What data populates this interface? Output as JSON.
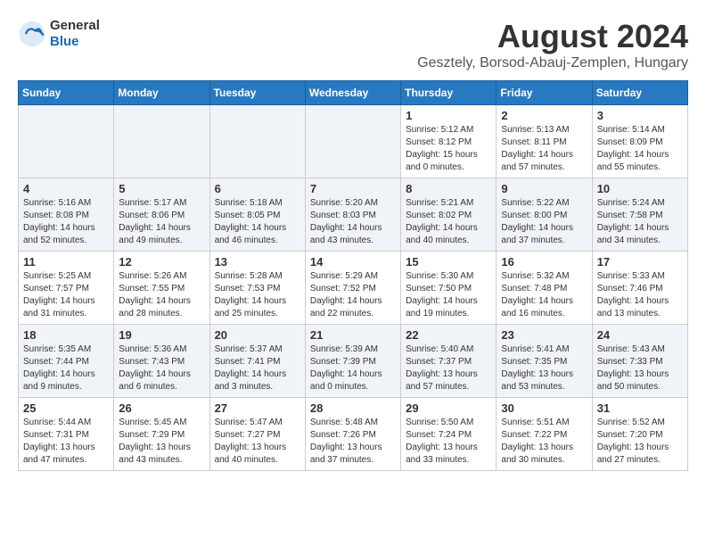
{
  "header": {
    "logo_general": "General",
    "logo_blue": "Blue",
    "month_year": "August 2024",
    "location": "Gesztely, Borsod-Abauj-Zemplen, Hungary"
  },
  "weekdays": [
    "Sunday",
    "Monday",
    "Tuesday",
    "Wednesday",
    "Thursday",
    "Friday",
    "Saturday"
  ],
  "weeks": [
    [
      {
        "day": "",
        "info": ""
      },
      {
        "day": "",
        "info": ""
      },
      {
        "day": "",
        "info": ""
      },
      {
        "day": "",
        "info": ""
      },
      {
        "day": "1",
        "info": "Sunrise: 5:12 AM\nSunset: 8:12 PM\nDaylight: 15 hours\nand 0 minutes."
      },
      {
        "day": "2",
        "info": "Sunrise: 5:13 AM\nSunset: 8:11 PM\nDaylight: 14 hours\nand 57 minutes."
      },
      {
        "day": "3",
        "info": "Sunrise: 5:14 AM\nSunset: 8:09 PM\nDaylight: 14 hours\nand 55 minutes."
      }
    ],
    [
      {
        "day": "4",
        "info": "Sunrise: 5:16 AM\nSunset: 8:08 PM\nDaylight: 14 hours\nand 52 minutes."
      },
      {
        "day": "5",
        "info": "Sunrise: 5:17 AM\nSunset: 8:06 PM\nDaylight: 14 hours\nand 49 minutes."
      },
      {
        "day": "6",
        "info": "Sunrise: 5:18 AM\nSunset: 8:05 PM\nDaylight: 14 hours\nand 46 minutes."
      },
      {
        "day": "7",
        "info": "Sunrise: 5:20 AM\nSunset: 8:03 PM\nDaylight: 14 hours\nand 43 minutes."
      },
      {
        "day": "8",
        "info": "Sunrise: 5:21 AM\nSunset: 8:02 PM\nDaylight: 14 hours\nand 40 minutes."
      },
      {
        "day": "9",
        "info": "Sunrise: 5:22 AM\nSunset: 8:00 PM\nDaylight: 14 hours\nand 37 minutes."
      },
      {
        "day": "10",
        "info": "Sunrise: 5:24 AM\nSunset: 7:58 PM\nDaylight: 14 hours\nand 34 minutes."
      }
    ],
    [
      {
        "day": "11",
        "info": "Sunrise: 5:25 AM\nSunset: 7:57 PM\nDaylight: 14 hours\nand 31 minutes."
      },
      {
        "day": "12",
        "info": "Sunrise: 5:26 AM\nSunset: 7:55 PM\nDaylight: 14 hours\nand 28 minutes."
      },
      {
        "day": "13",
        "info": "Sunrise: 5:28 AM\nSunset: 7:53 PM\nDaylight: 14 hours\nand 25 minutes."
      },
      {
        "day": "14",
        "info": "Sunrise: 5:29 AM\nSunset: 7:52 PM\nDaylight: 14 hours\nand 22 minutes."
      },
      {
        "day": "15",
        "info": "Sunrise: 5:30 AM\nSunset: 7:50 PM\nDaylight: 14 hours\nand 19 minutes."
      },
      {
        "day": "16",
        "info": "Sunrise: 5:32 AM\nSunset: 7:48 PM\nDaylight: 14 hours\nand 16 minutes."
      },
      {
        "day": "17",
        "info": "Sunrise: 5:33 AM\nSunset: 7:46 PM\nDaylight: 14 hours\nand 13 minutes."
      }
    ],
    [
      {
        "day": "18",
        "info": "Sunrise: 5:35 AM\nSunset: 7:44 PM\nDaylight: 14 hours\nand 9 minutes."
      },
      {
        "day": "19",
        "info": "Sunrise: 5:36 AM\nSunset: 7:43 PM\nDaylight: 14 hours\nand 6 minutes."
      },
      {
        "day": "20",
        "info": "Sunrise: 5:37 AM\nSunset: 7:41 PM\nDaylight: 14 hours\nand 3 minutes."
      },
      {
        "day": "21",
        "info": "Sunrise: 5:39 AM\nSunset: 7:39 PM\nDaylight: 14 hours\nand 0 minutes."
      },
      {
        "day": "22",
        "info": "Sunrise: 5:40 AM\nSunset: 7:37 PM\nDaylight: 13 hours\nand 57 minutes."
      },
      {
        "day": "23",
        "info": "Sunrise: 5:41 AM\nSunset: 7:35 PM\nDaylight: 13 hours\nand 53 minutes."
      },
      {
        "day": "24",
        "info": "Sunrise: 5:43 AM\nSunset: 7:33 PM\nDaylight: 13 hours\nand 50 minutes."
      }
    ],
    [
      {
        "day": "25",
        "info": "Sunrise: 5:44 AM\nSunset: 7:31 PM\nDaylight: 13 hours\nand 47 minutes."
      },
      {
        "day": "26",
        "info": "Sunrise: 5:45 AM\nSunset: 7:29 PM\nDaylight: 13 hours\nand 43 minutes."
      },
      {
        "day": "27",
        "info": "Sunrise: 5:47 AM\nSunset: 7:27 PM\nDaylight: 13 hours\nand 40 minutes."
      },
      {
        "day": "28",
        "info": "Sunrise: 5:48 AM\nSunset: 7:26 PM\nDaylight: 13 hours\nand 37 minutes."
      },
      {
        "day": "29",
        "info": "Sunrise: 5:50 AM\nSunset: 7:24 PM\nDaylight: 13 hours\nand 33 minutes."
      },
      {
        "day": "30",
        "info": "Sunrise: 5:51 AM\nSunset: 7:22 PM\nDaylight: 13 hours\nand 30 minutes."
      },
      {
        "day": "31",
        "info": "Sunrise: 5:52 AM\nSunset: 7:20 PM\nDaylight: 13 hours\nand 27 minutes."
      }
    ]
  ]
}
